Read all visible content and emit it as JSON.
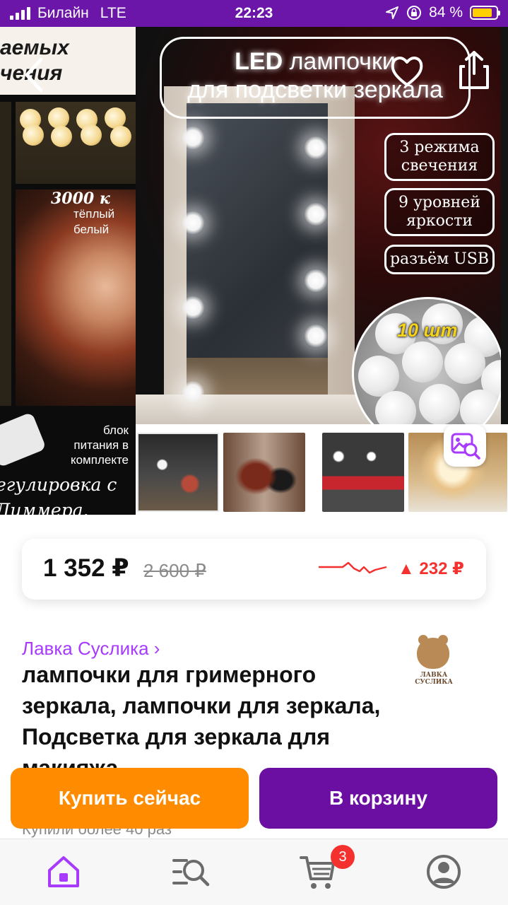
{
  "status_bar": {
    "carrier": "Билайн",
    "network": "LTE",
    "time": "22:23",
    "battery_percent": "84 %",
    "battery_level": 0.84,
    "icons": [
      "signal-icon",
      "location-icon",
      "rotation-lock-icon",
      "battery-icon"
    ]
  },
  "gallery": {
    "left_slide": {
      "banner": "аемых\nчения",
      "temperature": "3000 к",
      "tone": "тёплый\nбелый",
      "power_note": "блок\nпитания в\nкомплекте",
      "dimmer_note": "егулировка с\n Диммера."
    },
    "main_slide": {
      "title_bold": "LED",
      "title_rest": " лампочки\nдля подсветки зеркала",
      "features": [
        "3 режима\nсвечения",
        "9 уровней\nяркости",
        "разъём\nUSB"
      ],
      "count": "10 шт"
    },
    "thumbnails": [
      "photo-1",
      "photo-2",
      "photo-3",
      "photo-4"
    ]
  },
  "price": {
    "current": "1 352 ₽",
    "old": "2 600 ₽",
    "change": "▲ 232 ₽",
    "change_color": "#f4312e"
  },
  "product": {
    "seller": "Лавка Суслика ›",
    "seller_logo_text": "ЛАВКА СУСЛИКА",
    "title": "лампочки для гримерного зеркала, лампочки для зеркала, Подсветка для зеркала для макияжа",
    "bought": "Купили более 40 раз"
  },
  "actions": {
    "buy_now": "Купить сейчас",
    "add_to_cart": "В корзину"
  },
  "tab_bar": {
    "cart_badge": "3",
    "active_color": "#a73afd",
    "tabs": [
      "home-icon",
      "catalog-search-icon",
      "cart-icon",
      "profile-icon"
    ]
  },
  "colors": {
    "brand_purple": "#6b16a8",
    "cart_button": "#6b0fa3",
    "buy_button": "#ff8c00",
    "link_purple": "#a73afd"
  }
}
